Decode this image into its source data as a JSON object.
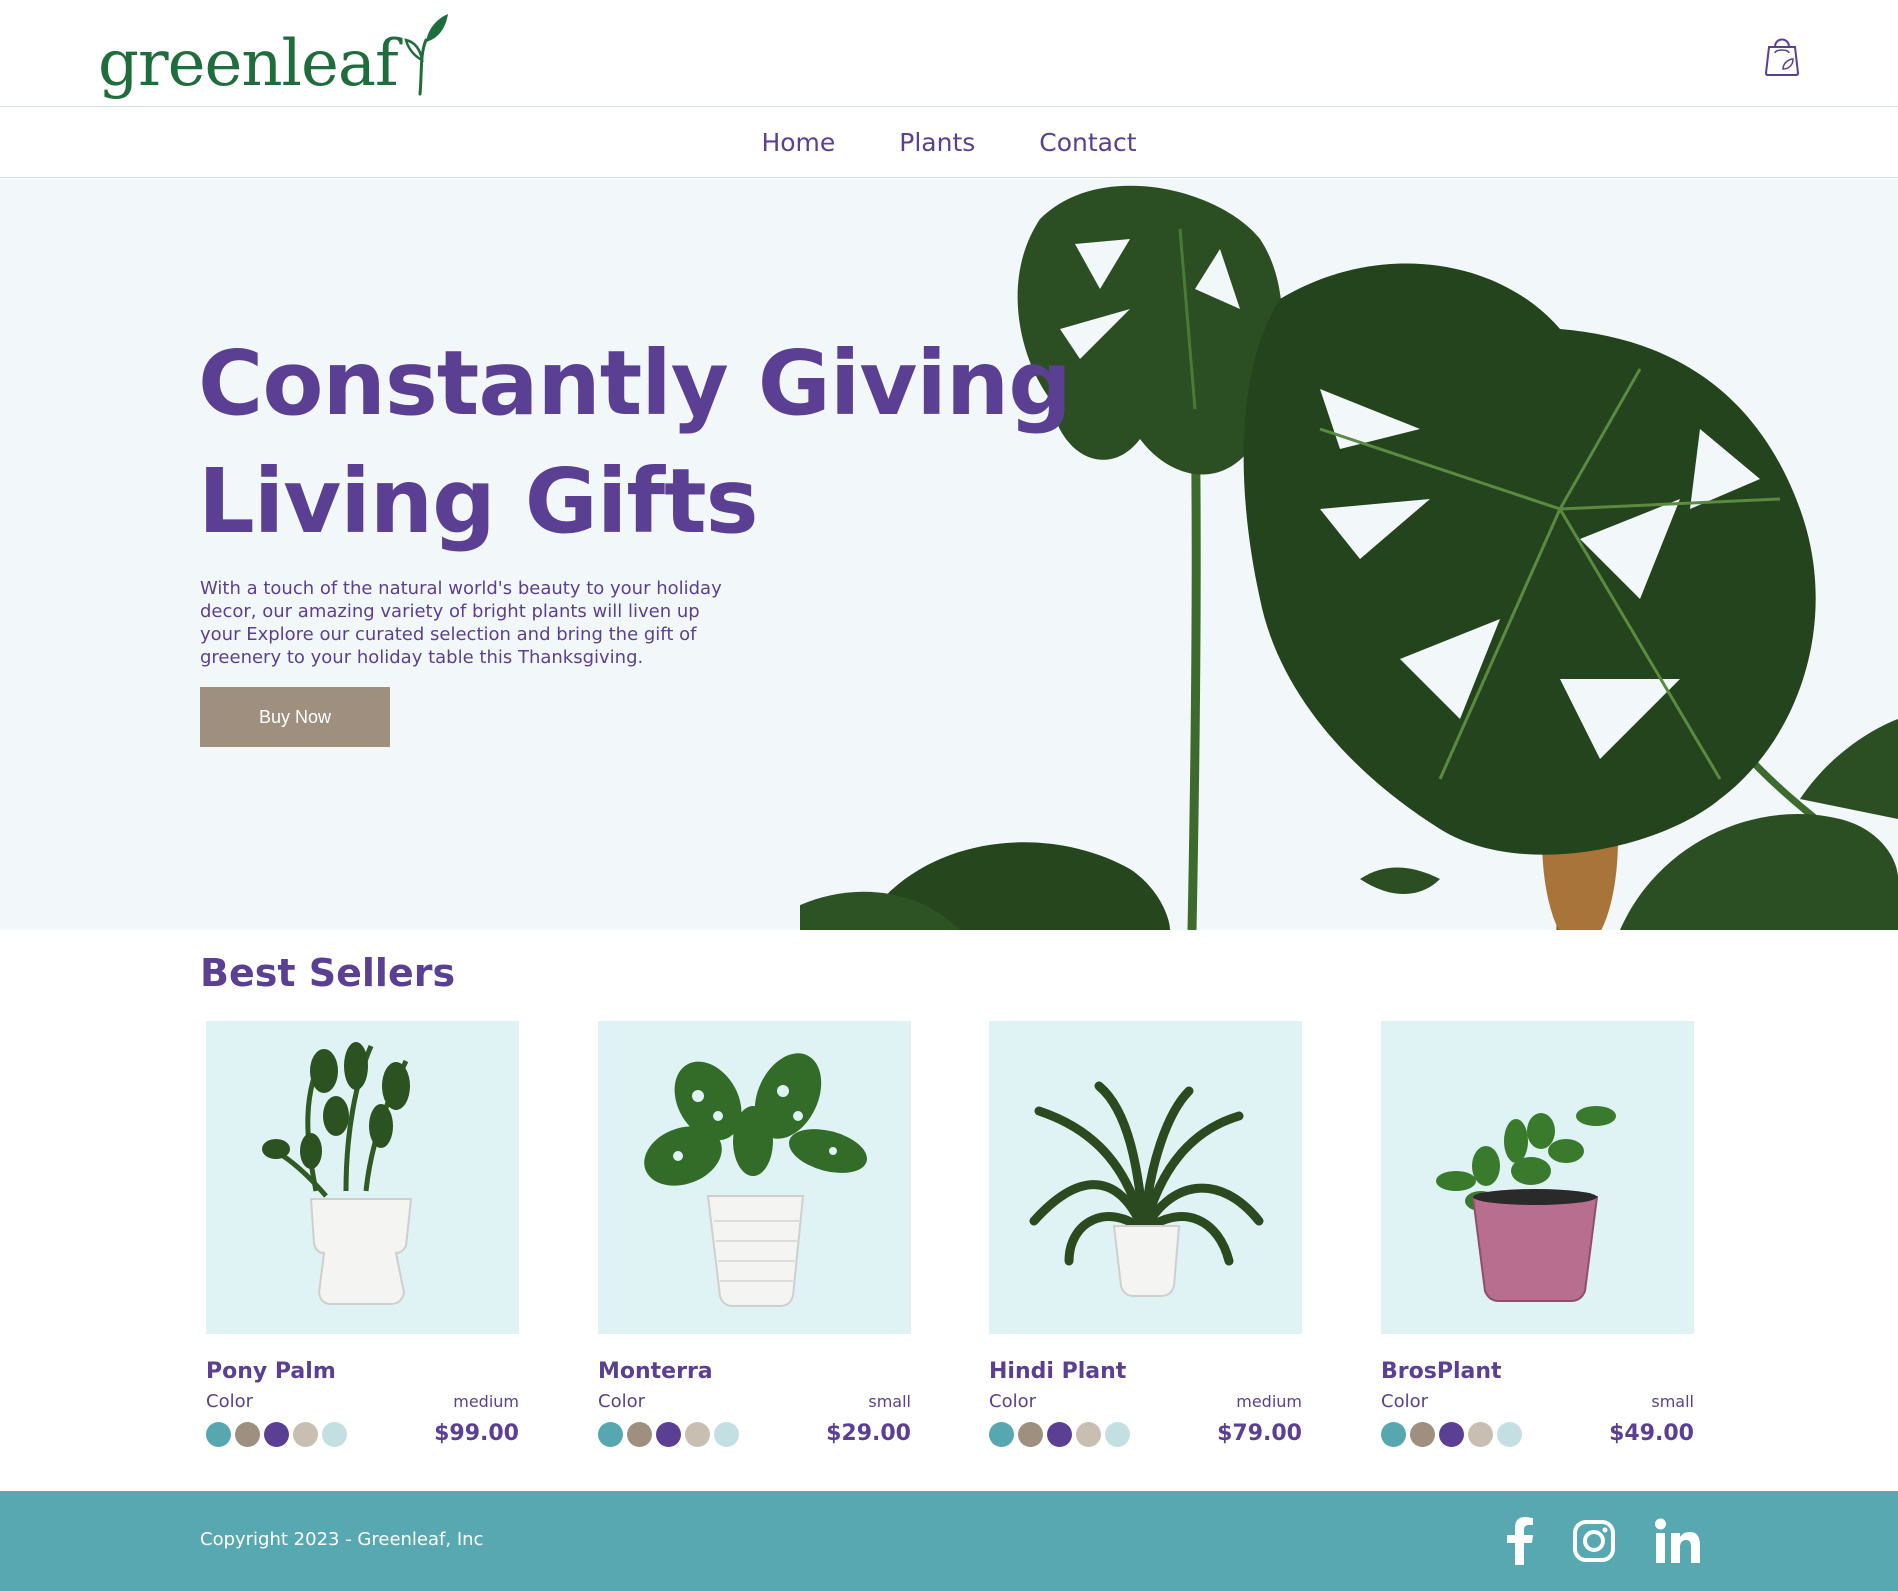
{
  "brand": {
    "name": "greenleaf"
  },
  "nav": {
    "items": [
      "Home",
      "Plants",
      "Contact"
    ]
  },
  "hero": {
    "title": "Constantly Giving\nLiving Gifts",
    "copy": "With a touch of the natural world's beauty to your holiday decor, our amazing variety of bright plants will liven up your Explore our curated selection and bring the gift of greenery to your holiday table this Thanksgiving.",
    "button": "Buy Now"
  },
  "best_sellers": {
    "title": "Best Sellers",
    "color_label": "Color",
    "products": [
      {
        "name": "Pony Palm",
        "size": "medium",
        "price": "$99.00"
      },
      {
        "name": "Monterra",
        "size": "small",
        "price": "$29.00"
      },
      {
        "name": "Hindi Plant",
        "size": "medium",
        "price": "$79.00"
      },
      {
        "name": "BrosPlant",
        "size": "small",
        "price": "$49.00"
      }
    ],
    "swatch_colors": [
      "#56a7b0",
      "#9e8f7e",
      "#5b3f93",
      "#c9beb2",
      "#c3dfe2"
    ]
  },
  "footer": {
    "copyright": "Copyright 2023 - Greenleaf, Inc",
    "social": [
      "facebook-icon",
      "instagram-icon",
      "linkedin-icon"
    ]
  },
  "colors": {
    "brand_purple": "#5b3f93",
    "brand_green": "#1f6d3c",
    "footer_teal": "#57a8b0",
    "button_taupe": "#9e8f7e"
  }
}
